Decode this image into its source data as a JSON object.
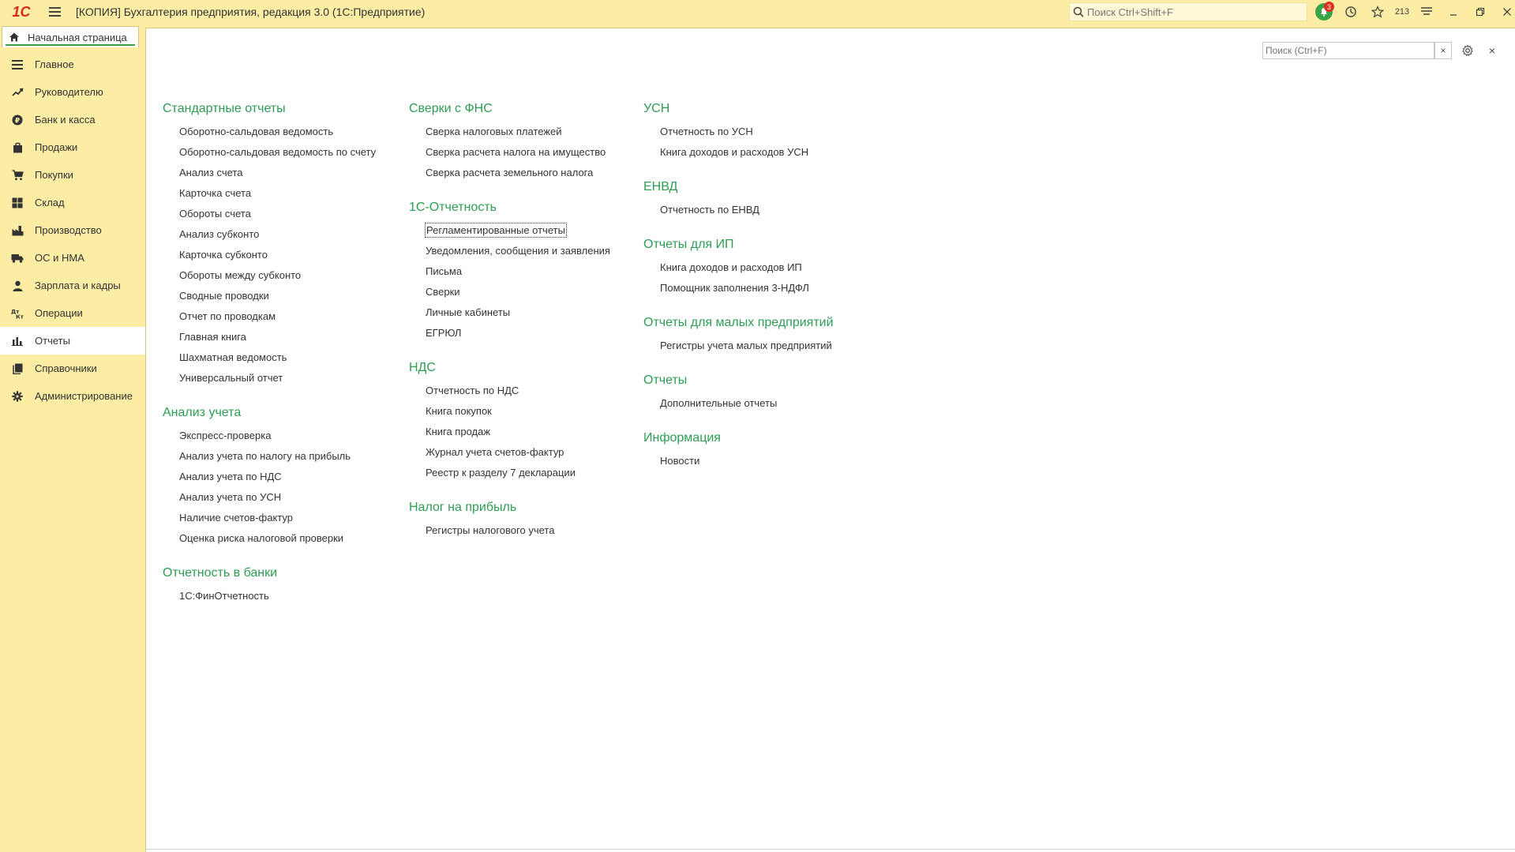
{
  "titlebar": {
    "logo": "1С",
    "title": "[КОПИЯ] Бухгалтерия предприятия, редакция 3.0  (1С:Предприятие)",
    "search_placeholder": "Поиск Ctrl+Shift+F",
    "notifications_count": "3",
    "favorites_count": "213"
  },
  "tabs": {
    "home_label": "Начальная страница"
  },
  "sidebar": {
    "items": [
      {
        "label": "Главное",
        "icon": "menu-lines-icon"
      },
      {
        "label": "Руководителю",
        "icon": "trend-icon"
      },
      {
        "label": "Банк и касса",
        "icon": "coin-icon"
      },
      {
        "label": "Продажи",
        "icon": "bag-icon"
      },
      {
        "label": "Покупки",
        "icon": "cart-icon"
      },
      {
        "label": "Склад",
        "icon": "warehouse-icon"
      },
      {
        "label": "Производство",
        "icon": "factory-icon"
      },
      {
        "label": "ОС и НМА",
        "icon": "truck-icon"
      },
      {
        "label": "Зарплата и кадры",
        "icon": "person-icon"
      },
      {
        "label": "Операции",
        "icon": "dt-kt-icon"
      },
      {
        "label": "Отчеты",
        "icon": "bar-chart-icon"
      },
      {
        "label": "Справочники",
        "icon": "books-icon"
      },
      {
        "label": "Администрирование",
        "icon": "gear-icon"
      }
    ],
    "active_index": 10
  },
  "main": {
    "search_placeholder": "Поиск (Ctrl+F)",
    "clear": "×",
    "close": "×",
    "columns": [
      {
        "groups": [
          {
            "title": "Стандартные отчеты",
            "items": [
              "Оборотно-сальдовая ведомость",
              "Оборотно-сальдовая ведомость по счету",
              "Анализ счета",
              "Карточка счета",
              "Обороты счета",
              "Анализ субконто",
              "Карточка субконто",
              "Обороты между субконто",
              "Сводные проводки",
              "Отчет по проводкам",
              "Главная книга",
              "Шахматная ведомость",
              "Универсальный отчет"
            ]
          },
          {
            "title": "Анализ учета",
            "items": [
              "Экспресс-проверка",
              "Анализ учета по налогу на прибыль",
              "Анализ учета по НДС",
              "Анализ учета по УСН",
              "Наличие счетов-фактур",
              "Оценка риска налоговой проверки"
            ]
          },
          {
            "title": "Отчетность в банки",
            "items": [
              "1С:ФинОтчетность"
            ]
          }
        ]
      },
      {
        "groups": [
          {
            "title": "Сверки с ФНС",
            "items": [
              "Сверка налоговых платежей",
              "Сверка расчета налога на имущество",
              "Сверка расчета земельного налога"
            ]
          },
          {
            "title": "1С-Отчетность",
            "items": [
              "Регламентированные отчеты",
              "Уведомления, сообщения и заявления",
              "Письма",
              "Сверки",
              "Личные кабинеты",
              "ЕГРЮЛ"
            ]
          },
          {
            "title": "НДС",
            "items": [
              "Отчетность по НДС",
              "Книга покупок",
              "Книга продаж",
              "Журнал учета счетов-фактур",
              "Реестр к разделу 7 декларации"
            ]
          },
          {
            "title": "Налог на прибыль",
            "items": [
              "Регистры налогового учета"
            ]
          }
        ]
      },
      {
        "groups": [
          {
            "title": "УСН",
            "items": [
              "Отчетность по УСН",
              "Книга доходов и расходов УСН"
            ]
          },
          {
            "title": "ЕНВД",
            "items": [
              "Отчетность по ЕНВД"
            ]
          },
          {
            "title": "Отчеты для ИП",
            "items": [
              "Книга доходов и расходов ИП",
              "Помощник заполнения 3-НДФЛ"
            ]
          },
          {
            "title": "Отчеты для малых предприятий",
            "items": [
              "Регистры учета малых предприятий"
            ]
          },
          {
            "title": "Отчеты",
            "items": [
              "Дополнительные отчеты"
            ]
          },
          {
            "title": "Информация",
            "items": [
              "Новости"
            ]
          }
        ]
      }
    ],
    "focused_item": "Регламентированные отчеты"
  },
  "colors": {
    "background": "#fbeda4",
    "accent_green": "#2e9d54",
    "badge_red": "#e0301e",
    "logo_red": "#d52b1e"
  }
}
